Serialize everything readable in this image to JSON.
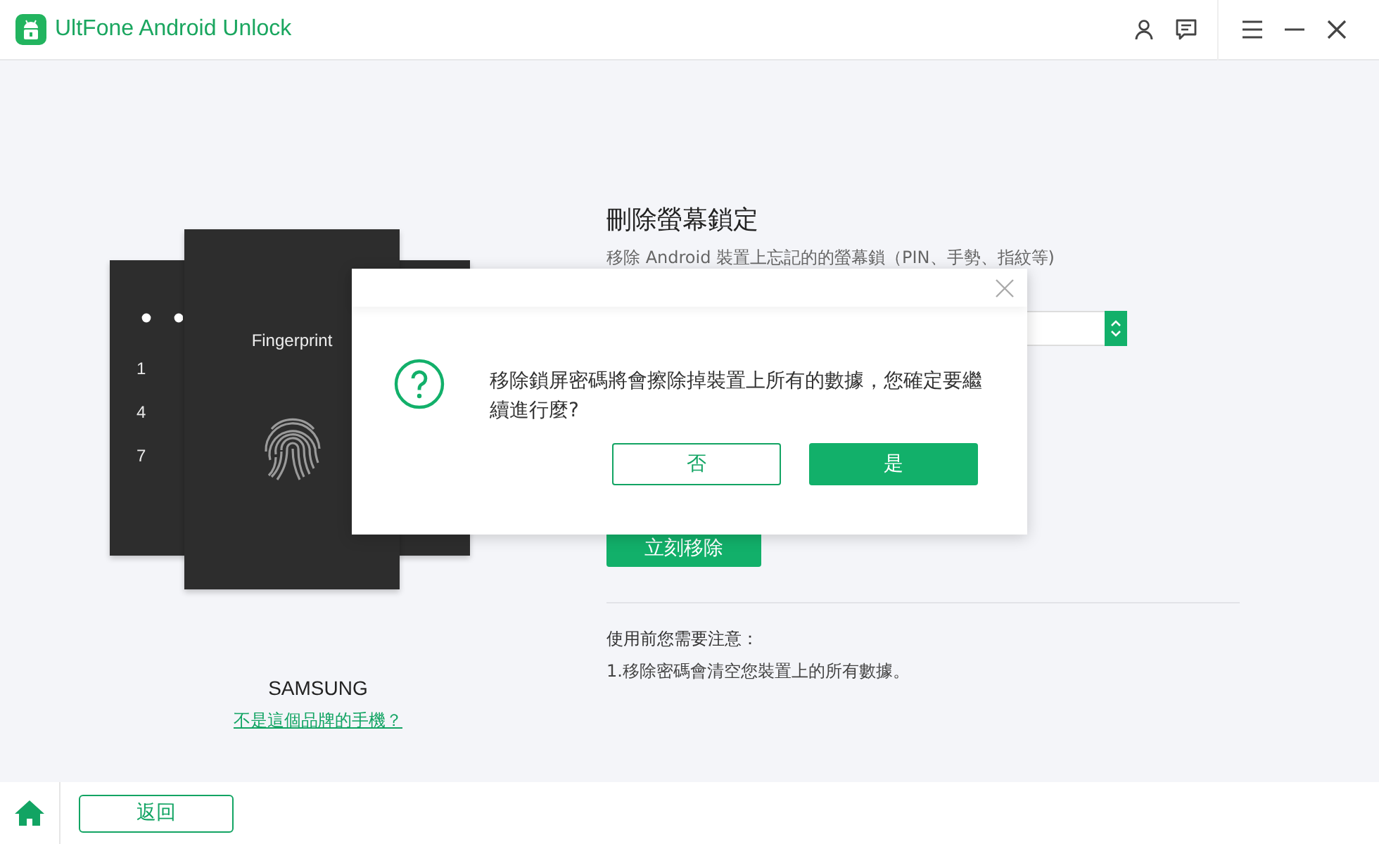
{
  "app": {
    "title": "UltFone Android Unlock"
  },
  "phones": [
    {
      "kind": "pin",
      "digits": [
        "1",
        "4",
        "7"
      ]
    },
    {
      "kind": "fingerprint",
      "label": "Fingerprint"
    }
  ],
  "brand": {
    "name": "SAMSUNG",
    "link": "不是這個品牌的手機？"
  },
  "panel": {
    "title": "刪除螢幕鎖定",
    "subtitle": "移除 Android 裝置上忘記的的螢幕鎖（PIN、手勢、指紋等)",
    "action": "立刻移除",
    "notes_title": "使用前您需要注意：",
    "notes": [
      "1.移除密碼會清空您裝置上的所有數據。"
    ]
  },
  "dialog": {
    "message": "移除鎖屏密碼將會擦除掉裝置上所有的數據，您確定要繼續進行麼?",
    "buttons": [
      {
        "label": "否",
        "kind": "secondary"
      },
      {
        "label": "是",
        "kind": "primary"
      }
    ]
  },
  "footer": {
    "back": "返回"
  }
}
